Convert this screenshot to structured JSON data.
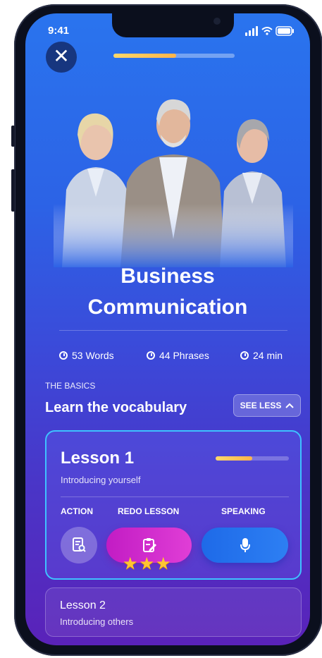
{
  "status": {
    "time": "9:41"
  },
  "progress_top": 0.52,
  "course": {
    "title_line1": "Business",
    "title_line2": "Communication"
  },
  "stats": [
    {
      "icon": "clock-icon",
      "label": "53 Words"
    },
    {
      "icon": "clock-icon",
      "label": "44 Phrases"
    },
    {
      "icon": "clock-icon",
      "label": "24 min"
    }
  ],
  "section": {
    "eyebrow": "THE BASICS",
    "title": "Learn the vocabulary",
    "toggle_label": "SEE LESS"
  },
  "lesson1": {
    "title": "Lesson 1",
    "subtitle": "Introducing yourself",
    "progress": 0.5,
    "columns": {
      "action": "ACTION",
      "redo": "REDO LESSON",
      "speaking": "SPEAKING"
    },
    "stars": 3
  },
  "lesson2": {
    "title": "Lesson 2",
    "subtitle": "Introducing others"
  },
  "colors": {
    "accent_yellow": "#ffb44a",
    "redo_magenta": "#d12ccd",
    "speak_blue": "#2170ee",
    "card_border": "#3ec2ff"
  }
}
